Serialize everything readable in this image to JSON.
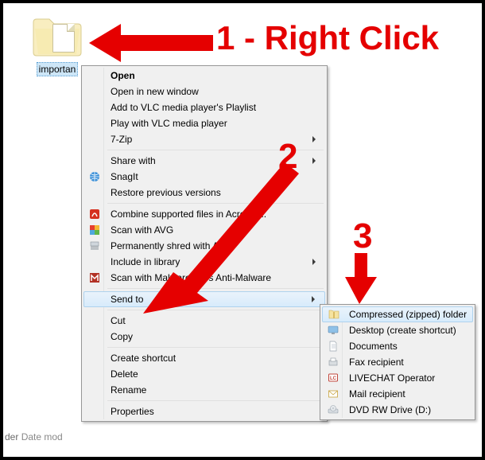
{
  "folder": {
    "label": "importan"
  },
  "status": {
    "label": "Date mod",
    "prefix": "der"
  },
  "annotations": {
    "a1": "1 - Right Click",
    "a2": "2",
    "a3": "3"
  },
  "menu": {
    "items": [
      {
        "label": "Open",
        "bold": true
      },
      {
        "label": "Open in new window"
      },
      {
        "label": "Add to VLC media player's Playlist"
      },
      {
        "label": "Play with VLC media player"
      },
      {
        "label": "7-Zip",
        "submenu": true
      },
      {
        "sep": true
      },
      {
        "label": "Share with",
        "submenu": true
      },
      {
        "label": "SnagIt",
        "icon": "snagit"
      },
      {
        "label": "Restore previous versions"
      },
      {
        "sep": true
      },
      {
        "label": "Combine supported files in Acrobat...",
        "icon": "acrobat"
      },
      {
        "label": "Scan with AVG",
        "icon": "avg"
      },
      {
        "label": "Permanently shred with AVG",
        "icon": "shred"
      },
      {
        "label": "Include in library",
        "submenu": true
      },
      {
        "label": "Scan with Malwarebytes Anti-Malware",
        "icon": "malware"
      },
      {
        "sep": true
      },
      {
        "label": "Send to",
        "submenu": true,
        "highlighted": true
      },
      {
        "sep": true
      },
      {
        "label": "Cut"
      },
      {
        "label": "Copy"
      },
      {
        "sep": true
      },
      {
        "label": "Create shortcut"
      },
      {
        "label": "Delete"
      },
      {
        "label": "Rename"
      },
      {
        "sep": true
      },
      {
        "label": "Properties"
      }
    ]
  },
  "submenu": {
    "items": [
      {
        "label": "Compressed (zipped) folder",
        "icon": "zip",
        "highlighted": true
      },
      {
        "label": "Desktop (create shortcut)",
        "icon": "desktop"
      },
      {
        "label": "Documents",
        "icon": "doc"
      },
      {
        "label": "Fax recipient",
        "icon": "fax"
      },
      {
        "label": "LIVECHAT Operator",
        "icon": "lc"
      },
      {
        "label": "Mail recipient",
        "icon": "mail"
      },
      {
        "label": "DVD RW Drive (D:)",
        "icon": "dvd"
      }
    ]
  }
}
